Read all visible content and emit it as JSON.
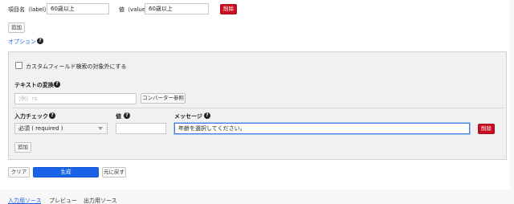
{
  "row": {
    "label_caption": "項目名（label）",
    "label_value": "60歳以上",
    "value_caption": "値（value）",
    "value_value": "60歳以上",
    "delete_label": "削除"
  },
  "add_label": "追加",
  "options": {
    "title": "オプション",
    "exclude_checkbox_label": "カスタムフィールド検索の対象外にする",
    "exclude_checked": false,
    "text_convert_title": "テキストの変換",
    "text_convert_placeholder": "(例）rs",
    "converter_ref_label": "コンバーター参照",
    "input_check_title": "入力チェック",
    "value_title": "値",
    "message_title": "メッセージ",
    "check_select_value": "必須 ( required )",
    "check_value": "",
    "message_value": "年齢を選択してください。",
    "check_delete_label": "削除",
    "check_add_label": "追加"
  },
  "actions": {
    "clear_label": "クリア",
    "generate_label": "生成",
    "undo_label": "元に戻す"
  },
  "tabs": [
    {
      "label": "入力用ソース",
      "active": true
    },
    {
      "label": "プレビュー",
      "active": false
    },
    {
      "label": "出力用ソース",
      "active": false
    }
  ],
  "help_glyph": "?",
  "colors": {
    "accent_blue": "#1a63e8",
    "danger_red": "#c70f1f",
    "focus_border": "#3f7fe0"
  }
}
